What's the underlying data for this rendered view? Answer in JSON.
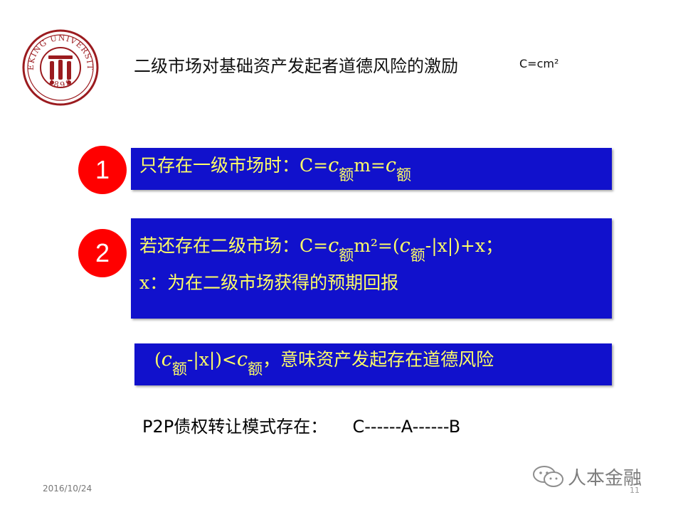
{
  "header": {
    "title": "二级市场对基础资产发起者道德风险的激励",
    "formula": "C=cm²",
    "logo": {
      "text_top": "PEKING UNIVERSITY",
      "year": "1898",
      "colors": {
        "ring": "#9b1b1f",
        "bg": "#ffffff"
      }
    }
  },
  "items": [
    {
      "number": "1",
      "lines": [
        {
          "t1": "只存在一级市场时：C=",
          "v1": "c",
          "s1": "额",
          "t2": "m=",
          "v2": "c",
          "s2": "额"
        }
      ]
    },
    {
      "number": "2",
      "lines": [
        {
          "t1": "若还存在二级市场：C=",
          "v1": "c",
          "s1": "额",
          "t2": "m²=(",
          "v2": "c",
          "s2": "额",
          "t3": "-|x|)+x；"
        },
        {
          "t1": "x：为在二级市场获得的预期回报"
        }
      ]
    }
  ],
  "conclusion": {
    "t1": "(",
    "v1": "c",
    "s1": "额",
    "t2": "-|x|)<",
    "v2": "c",
    "s2": "额",
    "t3": "，意味资产发起存在道德风险"
  },
  "p2p": {
    "text": "P2P债权转让模式存在：",
    "chain": "C------A------B"
  },
  "footer": {
    "date": "2016/10/24",
    "page": "11"
  },
  "watermark": {
    "text": "人本金融"
  },
  "colors": {
    "box": "#1111cc",
    "box_text": "#ffff66",
    "circle": "#ff0000"
  }
}
